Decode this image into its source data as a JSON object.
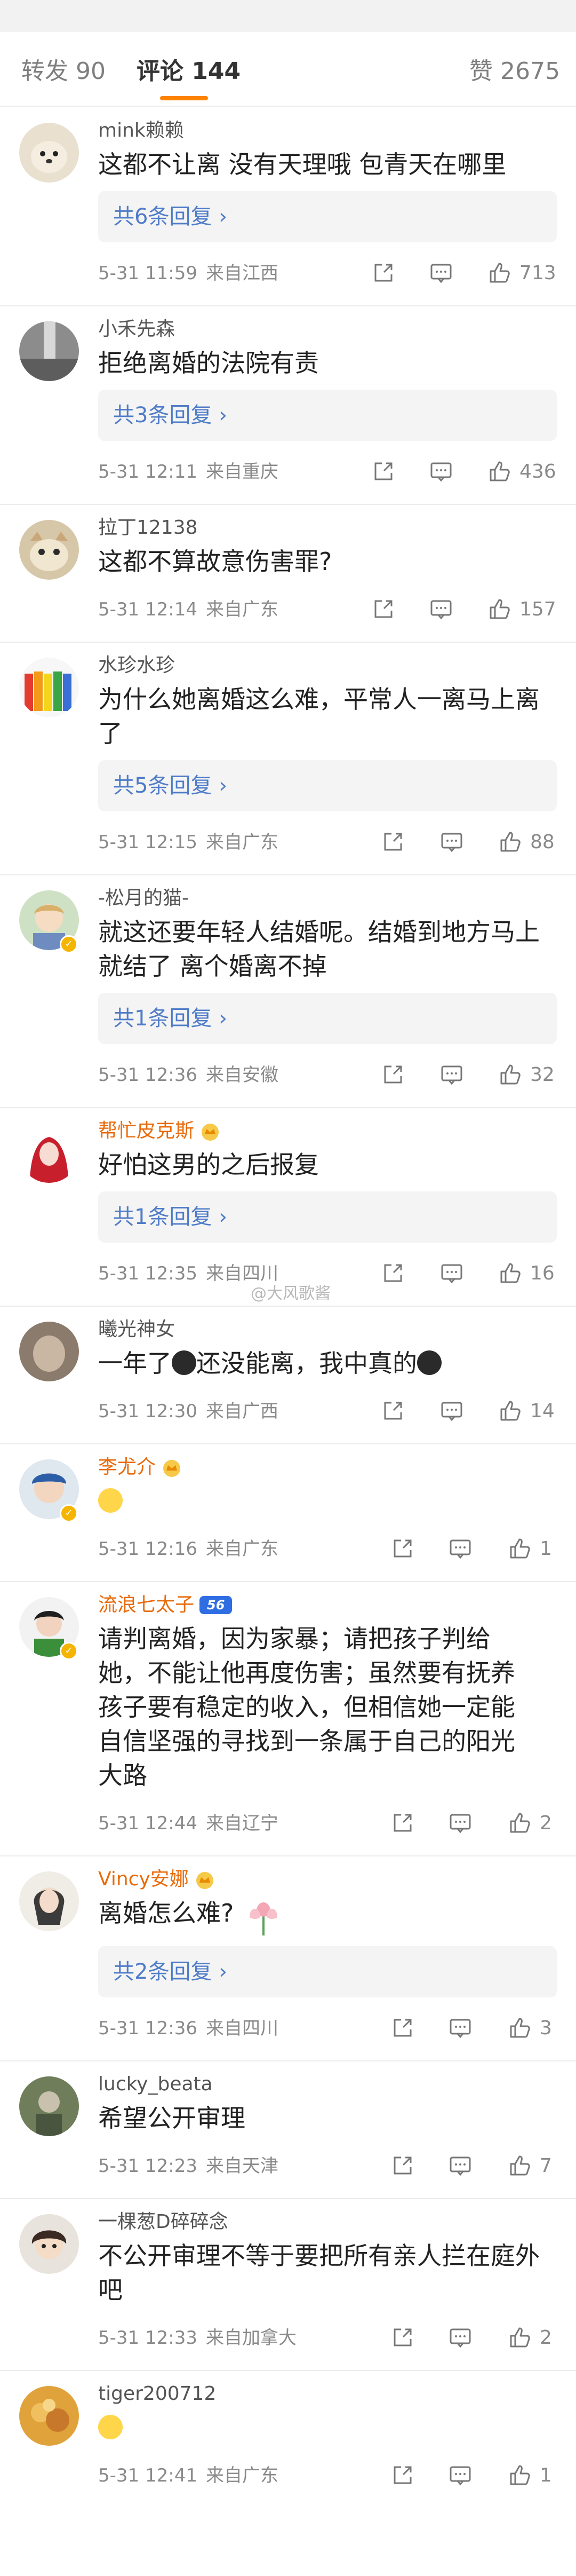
{
  "tabs": {
    "repost": "转发 90",
    "comments": "评论 144",
    "likes": "赞 2675"
  },
  "watermark": "@大风歌酱",
  "icons": {
    "share": "share-icon",
    "comment": "comment-icon",
    "like": "thumbs-up-icon"
  },
  "comments": [
    {
      "user": "mink赖赖",
      "text": "这都不让离 没有天理哦 包青天在哪里",
      "replies": "共6条回复 ›",
      "date": "5-31 11:59",
      "location": "来自江西",
      "likes": "713"
    },
    {
      "user": "小禾先森",
      "text": "拒绝离婚的法院有责",
      "replies": "共3条回复 ›",
      "date": "5-31 12:11",
      "location": "来自重庆",
      "likes": "436"
    },
    {
      "user": "拉丁12138",
      "text": "这都不算故意伤害罪?",
      "date": "5-31 12:14",
      "location": "来自广东",
      "likes": "157"
    },
    {
      "user": "水珍水珍",
      "text": "为什么她离婚这么难，平常人一离马上离了",
      "replies": "共5条回复 ›",
      "date": "5-31 12:15",
      "location": "来自广东",
      "likes": "88"
    },
    {
      "user": "-松月的猫-",
      "text": "就这还要年轻人结婚呢。结婚到地方马上就结了 离个婚离不掉",
      "replies": "共1条回复 ›",
      "date": "5-31 12:36",
      "location": "来自安徽",
      "likes": "32"
    },
    {
      "user": "帮忙皮克斯",
      "text": "好怕这男的之后报复",
      "replies": "共1条回复 ›",
      "date": "5-31 12:35",
      "location": "来自四川",
      "likes": "16"
    },
    {
      "user": "曦光神女",
      "text_a": "一年了",
      "text_b": "还没能离，我中真的",
      "date": "5-31 12:30",
      "location": "来自广西",
      "likes": "14"
    },
    {
      "user": "李尤介",
      "date": "5-31 12:16",
      "location": "来自广东",
      "likes": "1"
    },
    {
      "user": "流浪七太子",
      "level": "56",
      "text": "请判离婚，因为家暴；请把孩子判给她，不能让他再度伤害；虽然要有抚养孩子要有稳定的收入，但相信她一定能自信坚强的寻找到一条属于自己的阳光大路",
      "date": "5-31 12:44",
      "location": "来自辽宁",
      "likes": "2"
    },
    {
      "user": "Vincy安娜",
      "text": "离婚怎么难?",
      "replies": "共2条回复 ›",
      "date": "5-31 12:36",
      "location": "来自四川",
      "likes": "3"
    },
    {
      "user": "lucky_beata",
      "text": "希望公开审理",
      "date": "5-31 12:23",
      "location": "来自天津",
      "likes": "7"
    },
    {
      "user": "一棵葱D碎碎念",
      "text": "不公开审理不等于要把所有亲人拦在庭外吧",
      "date": "5-31 12:33",
      "location": "来自加拿大",
      "likes": "2"
    },
    {
      "user": "tiger200712",
      "date": "5-31 12:41",
      "location": "来自广东",
      "likes": "1"
    }
  ]
}
